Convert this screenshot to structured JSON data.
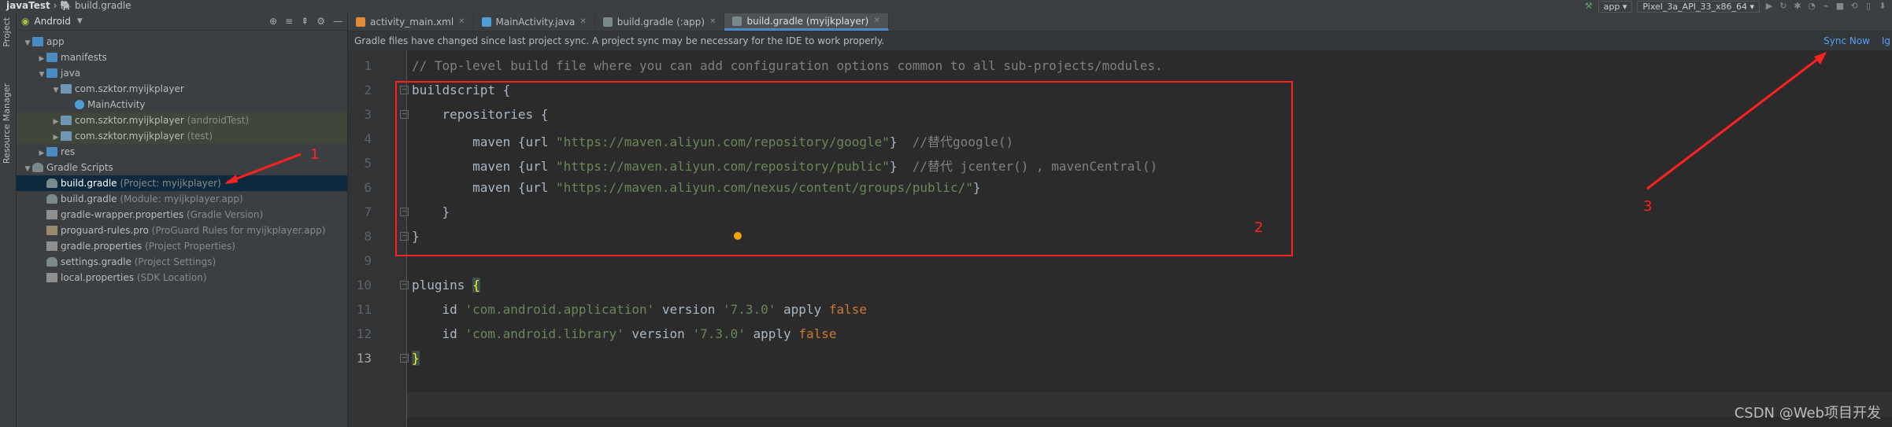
{
  "titlebar": {
    "project": "javaTest",
    "file": "build.gradle",
    "run_config": "app",
    "device": "Pixel_3a_API_33_x86_64"
  },
  "toolstrip": {
    "project_tab": "Project",
    "resource_tab": "Resource Manager"
  },
  "project_panel": {
    "view_mode": "Android",
    "tree": [
      {
        "label": "app",
        "hint": "",
        "icon": "folder",
        "indent": 0,
        "arrow": "down",
        "state": ""
      },
      {
        "label": "manifests",
        "hint": "",
        "icon": "folder",
        "indent": 1,
        "arrow": "right",
        "state": ""
      },
      {
        "label": "java",
        "hint": "",
        "icon": "folder",
        "indent": 1,
        "arrow": "down",
        "state": ""
      },
      {
        "label": "com.szktor.myijkplayer",
        "hint": "",
        "icon": "package",
        "indent": 2,
        "arrow": "down",
        "state": ""
      },
      {
        "label": "MainActivity",
        "hint": "",
        "icon": "class",
        "indent": 3,
        "arrow": "",
        "state": ""
      },
      {
        "label": "com.szktor.myijkplayer",
        "hint": " (androidTest)",
        "icon": "package",
        "indent": 2,
        "arrow": "right",
        "state": "hl"
      },
      {
        "label": "com.szktor.myijkplayer",
        "hint": " (test)",
        "icon": "package",
        "indent": 2,
        "arrow": "right",
        "state": "hl"
      },
      {
        "label": "res",
        "hint": "",
        "icon": "folder",
        "indent": 1,
        "arrow": "right",
        "state": ""
      },
      {
        "label": "Gradle Scripts",
        "hint": "",
        "icon": "gradle",
        "indent": 0,
        "arrow": "down",
        "state": ""
      },
      {
        "label": "build.gradle",
        "hint": " (Project: myijkplayer)",
        "icon": "gradle",
        "indent": 1,
        "arrow": "",
        "state": "sel"
      },
      {
        "label": "build.gradle",
        "hint": " (Module: myijkplayer.app)",
        "icon": "gradle",
        "indent": 1,
        "arrow": "",
        "state": ""
      },
      {
        "label": "gradle-wrapper.properties",
        "hint": " (Gradle Version)",
        "icon": "prop",
        "indent": 1,
        "arrow": "",
        "state": ""
      },
      {
        "label": "proguard-rules.pro",
        "hint": " (ProGuard Rules for myijkplayer.app)",
        "icon": "pro",
        "indent": 1,
        "arrow": "",
        "state": ""
      },
      {
        "label": "gradle.properties",
        "hint": " (Project Properties)",
        "icon": "prop",
        "indent": 1,
        "arrow": "",
        "state": ""
      },
      {
        "label": "settings.gradle",
        "hint": " (Project Settings)",
        "icon": "gradle",
        "indent": 1,
        "arrow": "",
        "state": ""
      },
      {
        "label": "local.properties",
        "hint": " (SDK Location)",
        "icon": "prop",
        "indent": 1,
        "arrow": "",
        "state": ""
      }
    ]
  },
  "editor": {
    "tabs": [
      {
        "label": "activity_main.xml",
        "color": "#e08b3a",
        "active": false
      },
      {
        "label": "MainActivity.java",
        "color": "#4e9fd6",
        "active": false
      },
      {
        "label": "build.gradle (:app)",
        "color": "#7a8a8c",
        "active": false
      },
      {
        "label": "build.gradle (myijkplayer)",
        "color": "#7a8a8c",
        "active": true
      }
    ],
    "banner": {
      "message": "Gradle files have changed since last project sync. A project sync may be necessary for the IDE to work properly.",
      "sync_label": "Sync Now",
      "ignore_label": "Ig"
    },
    "line_numbers": [
      "1",
      "2",
      "3",
      "4",
      "5",
      "6",
      "7",
      "8",
      "9",
      "10",
      "11",
      "12",
      "13"
    ],
    "lines": [
      [
        {
          "t": "// Top-level build file where you can add configuration options common to all sub-projects/modules.",
          "c": "com"
        }
      ],
      [
        {
          "t": "buildscript {",
          "c": ""
        }
      ],
      [
        {
          "t": "    repositories {",
          "c": ""
        }
      ],
      [
        {
          "t": "        maven {url ",
          "c": ""
        },
        {
          "t": "\"https://maven.aliyun.com/repository/google\"",
          "c": "str"
        },
        {
          "t": "}  ",
          "c": ""
        },
        {
          "t": "//替代google()",
          "c": "com"
        }
      ],
      [
        {
          "t": "        maven {url ",
          "c": ""
        },
        {
          "t": "\"https://maven.aliyun.com/repository/public\"",
          "c": "str"
        },
        {
          "t": "}  ",
          "c": ""
        },
        {
          "t": "//替代 jcenter() , mavenCentral()",
          "c": "com"
        }
      ],
      [
        {
          "t": "        maven {url ",
          "c": ""
        },
        {
          "t": "\"https://maven.aliyun.com/nexus/content/groups/public/\"",
          "c": "str"
        },
        {
          "t": "}",
          "c": ""
        }
      ],
      [
        {
          "t": "    }",
          "c": ""
        }
      ],
      [
        {
          "t": "}",
          "c": ""
        }
      ],
      [
        {
          "t": "",
          "c": ""
        }
      ],
      [
        {
          "t": "plugins ",
          "c": ""
        },
        {
          "t": "{",
          "c": "hl"
        }
      ],
      [
        {
          "t": "    id ",
          "c": ""
        },
        {
          "t": "'com.android.application'",
          "c": "str"
        },
        {
          "t": " version ",
          "c": ""
        },
        {
          "t": "'7.3.0'",
          "c": "str"
        },
        {
          "t": " apply ",
          "c": ""
        },
        {
          "t": "false",
          "c": "kw"
        }
      ],
      [
        {
          "t": "    id ",
          "c": ""
        },
        {
          "t": "'com.android.library'",
          "c": "str"
        },
        {
          "t": " version ",
          "c": ""
        },
        {
          "t": "'7.3.0'",
          "c": "str"
        },
        {
          "t": " apply ",
          "c": ""
        },
        {
          "t": "false",
          "c": "kw"
        }
      ],
      [
        {
          "t": "}",
          "c": "hl"
        }
      ]
    ]
  },
  "annotations": {
    "n1": "1",
    "n2": "2",
    "n3": "3"
  },
  "watermark": "CSDN @Web项目开发"
}
